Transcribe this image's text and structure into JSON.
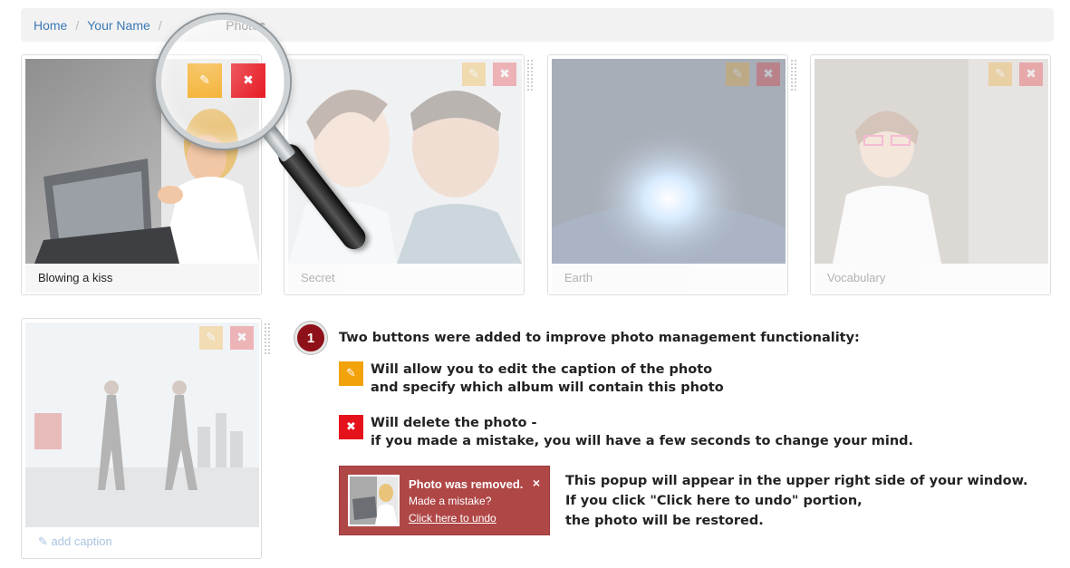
{
  "breadcrumb": {
    "items": [
      "Home",
      "Your Name",
      "Photos"
    ]
  },
  "photos": [
    {
      "caption": "Blowing a kiss"
    },
    {
      "caption": "Secret"
    },
    {
      "caption": "Earth"
    },
    {
      "caption": "Vocabulary"
    },
    {
      "caption": ""
    }
  ],
  "add_caption_label": "add caption",
  "icons": {
    "edit": "pencil-icon",
    "delete": "close-icon"
  },
  "colors": {
    "edit": "#f2a20a",
    "delete": "#e6121b",
    "toast": "#b04747",
    "badge": "#8e1019",
    "link": "#3a78b5"
  },
  "tutorial": {
    "step_number": "1",
    "intro": "Two buttons were added to improve photo management functionality:",
    "edit_line1": "Will allow you to edit the caption of the photo",
    "edit_line2": "and specify which album will contain this photo",
    "delete_line1": "Will delete the photo -",
    "delete_line2": "if you made a mistake, you will have a few seconds to change your mind.",
    "popup_line1": "This popup will appear in the upper right side of your window.",
    "popup_line2": "If you click \"Click here to undo\" portion,",
    "popup_line3": "the photo will be restored."
  },
  "toast": {
    "title": "Photo was removed.",
    "message": "Made a mistake?",
    "undo_link": "Click here to undo",
    "close": "×"
  }
}
